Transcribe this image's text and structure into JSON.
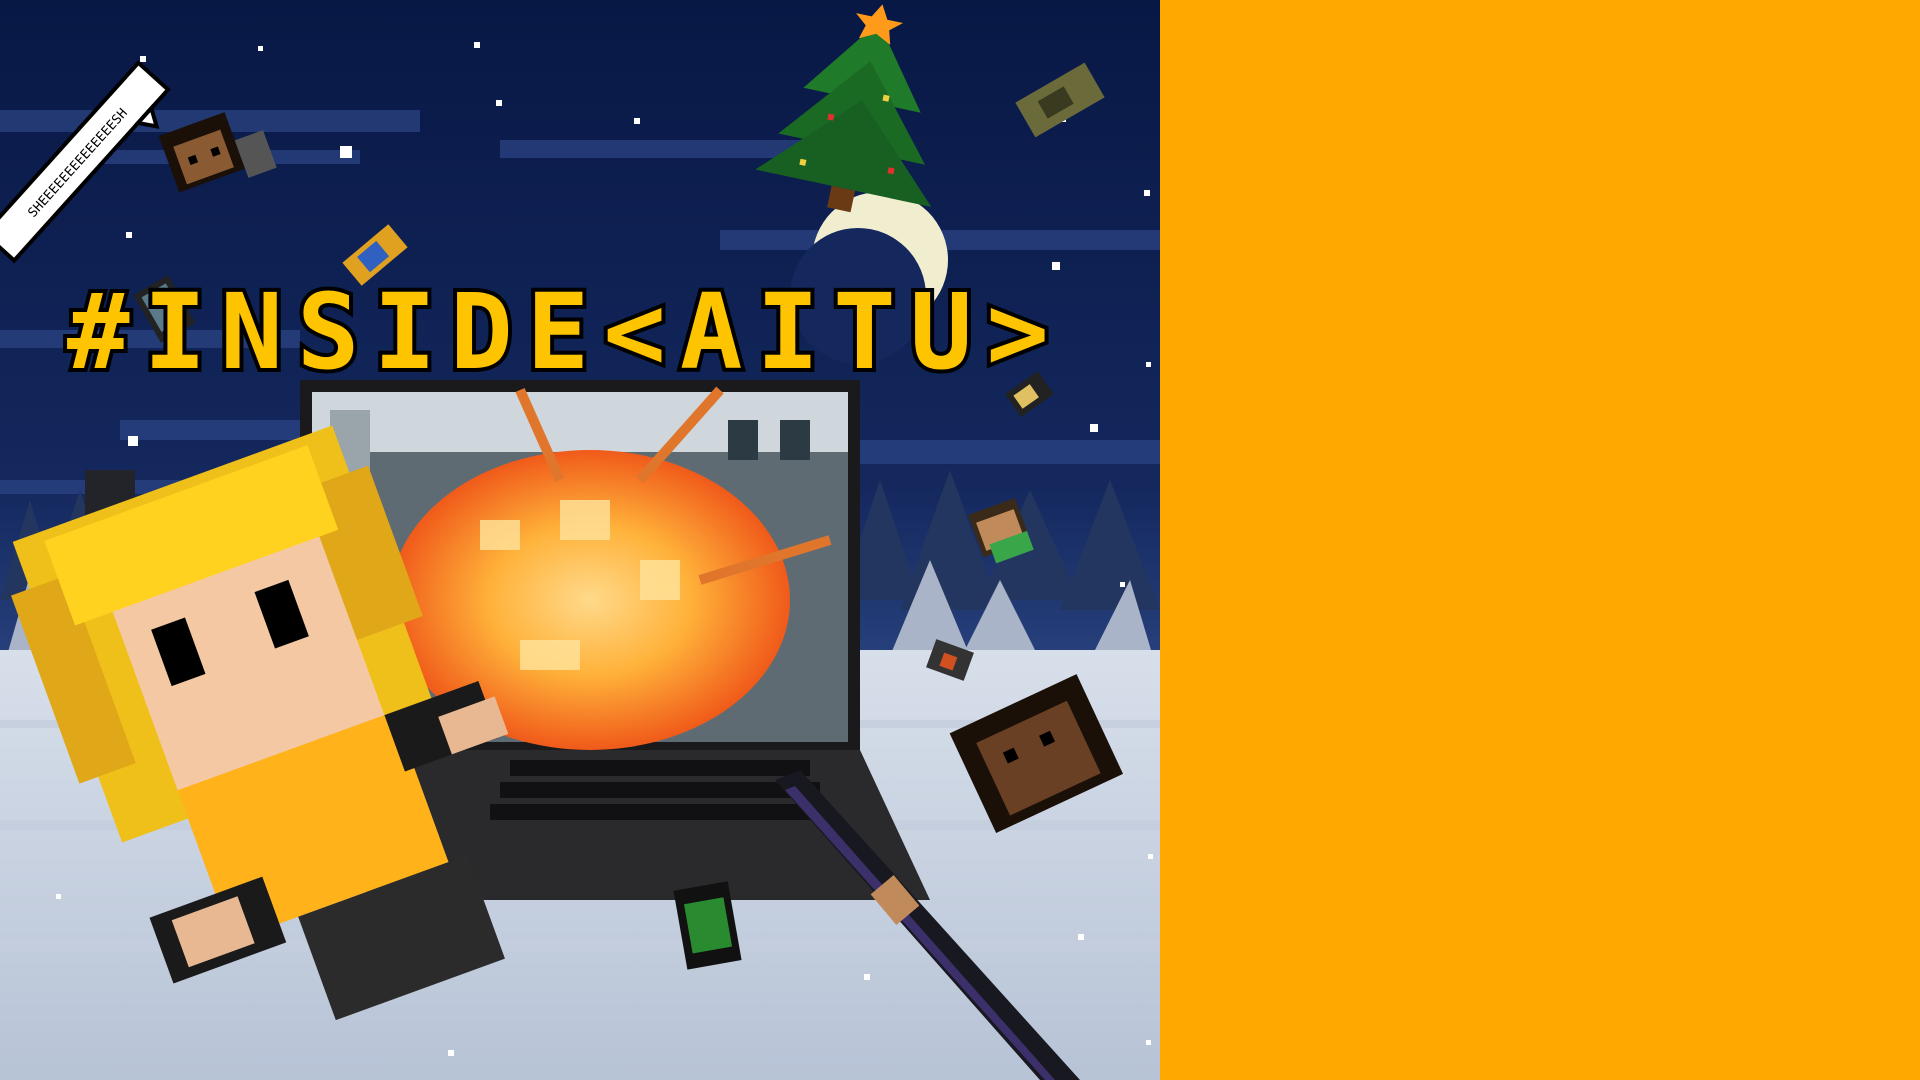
{
  "scene": {
    "title": "#INSIDE<AITU>",
    "speech_bubble": "SHEEEEEEEEEEEEEESH",
    "colors": {
      "sky_top": "#0a1a4a",
      "sky_bottom": "#1e3570",
      "snow_ground": "#c9d3e2",
      "panel": "#ffa800",
      "title_fill": "#ffc400",
      "title_outline": "#000000",
      "explosion": "#ff8a1a"
    }
  }
}
